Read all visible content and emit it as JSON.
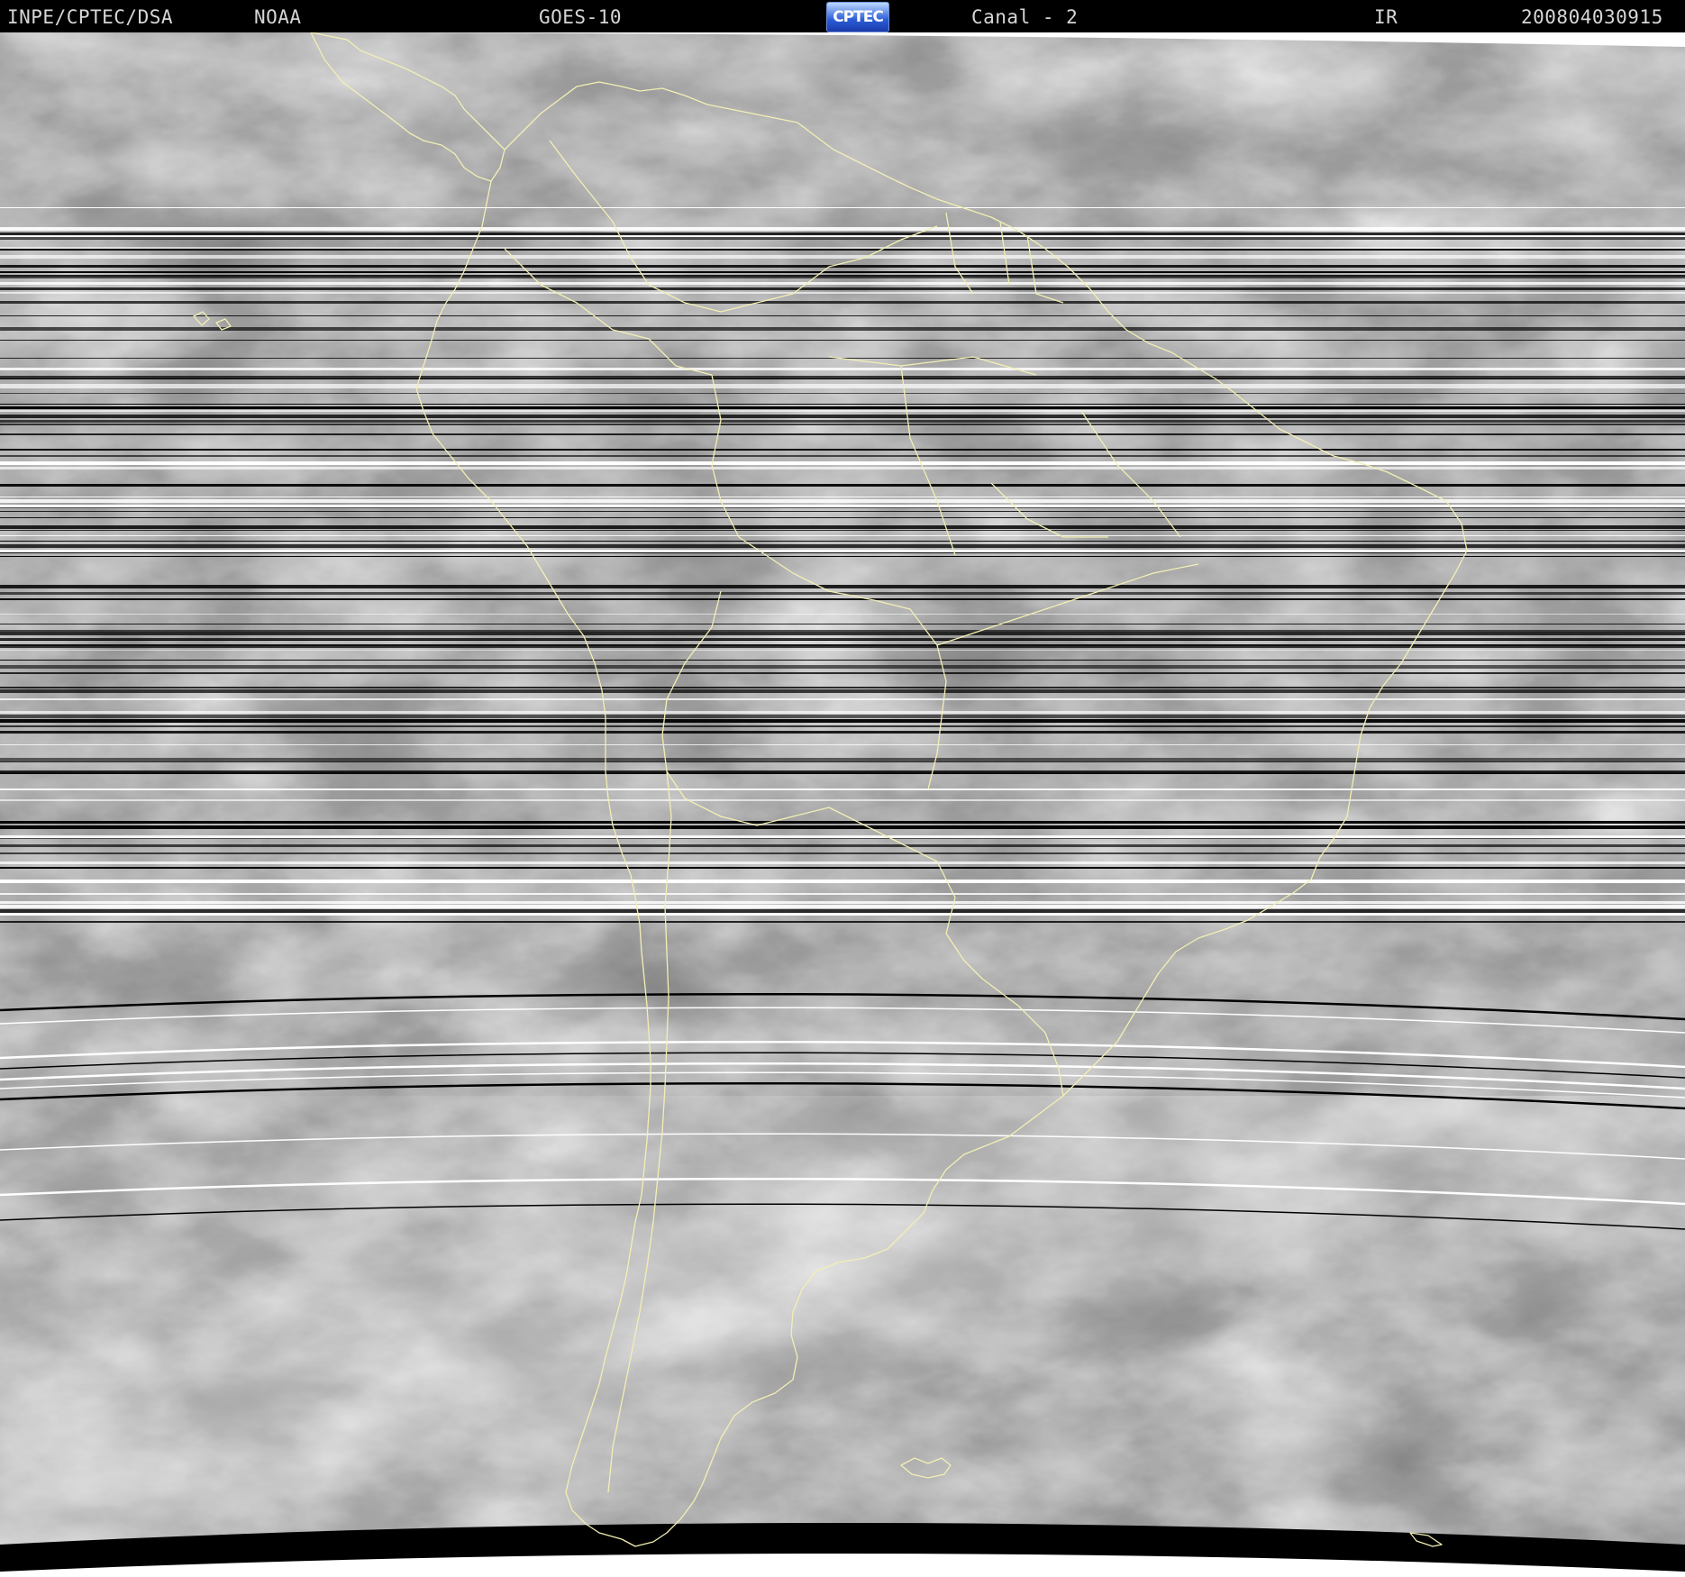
{
  "header": {
    "agency": "INPE/CPTEC/DSA",
    "source": "NOAA",
    "satellite": "GOES-10",
    "logo_text": "CPTEC",
    "channel": "Canal - 2",
    "band": "IR",
    "timestamp": "200804030915"
  },
  "colors": {
    "header_background": "#000000",
    "header_text": "#d6d6d6",
    "boundary_lines": "#f3efb4",
    "logo_blue": "#2b5bd6"
  },
  "imagery": {
    "type": "satellite-infrared-mosaic",
    "region": "South America",
    "boundaries_overlay": true,
    "scanline_dropouts": true
  }
}
